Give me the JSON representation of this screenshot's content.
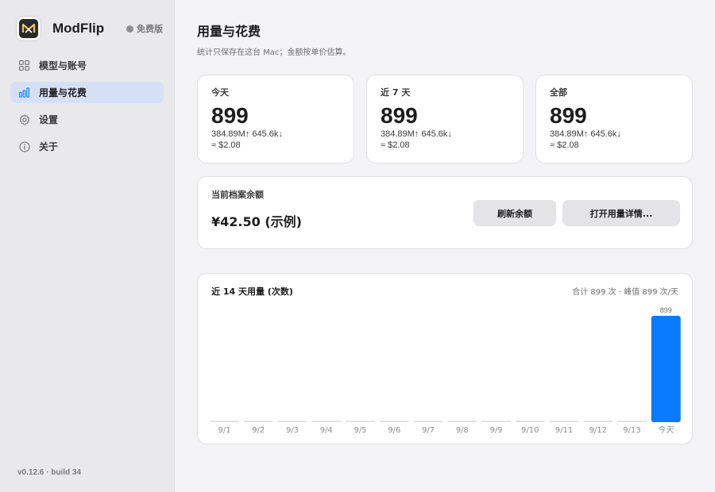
{
  "app": {
    "name": "ModFlip",
    "plan": "免费版",
    "version": "v0.12.6 · build 34"
  },
  "sidebar": {
    "items": [
      {
        "label": "模型与账号",
        "icon": "grid-icon",
        "active": false
      },
      {
        "label": "用量与花费",
        "icon": "bar-chart-icon",
        "active": true
      },
      {
        "label": "设置",
        "icon": "gear-icon",
        "active": false
      },
      {
        "label": "关于",
        "icon": "info-icon",
        "active": false
      }
    ]
  },
  "page": {
    "title": "用量与花费",
    "subtitle": "统计只保存在这台 Mac；金额按单价估算。"
  },
  "stats": [
    {
      "label": "今天",
      "value": "899",
      "tokens": "384.89M↑ 645.6k↓",
      "cost": "≈ $2.08"
    },
    {
      "label": "近 7 天",
      "value": "899",
      "tokens": "384.89M↑ 645.6k↓",
      "cost": "≈ $2.08"
    },
    {
      "label": "全部",
      "value": "899",
      "tokens": "384.89M↑ 645.6k↓",
      "cost": "≈ $2.08"
    }
  ],
  "balance": {
    "label": "当前档案余额",
    "value": "¥42.50 (示例)",
    "refresh_label": "刷新余额",
    "open_label": "打开用量详情..."
  },
  "chart": {
    "title": "近 14 天用量 (次数)",
    "summary": "合计 899 次 · 峰值 899 次/天"
  },
  "chart_data": {
    "type": "bar",
    "categories": [
      "9/1",
      "9/2",
      "9/3",
      "9/4",
      "9/5",
      "9/6",
      "9/7",
      "9/8",
      "9/9",
      "9/10",
      "9/11",
      "9/12",
      "9/13",
      "今天"
    ],
    "values": [
      0,
      0,
      0,
      0,
      0,
      0,
      0,
      0,
      0,
      0,
      0,
      0,
      0,
      899
    ],
    "data_labels": [
      "",
      "",
      "",
      "",
      "",
      "",
      "",
      "",
      "",
      "",
      "",
      "",
      "",
      "899"
    ],
    "ylim": [
      0,
      899
    ],
    "grid": false,
    "bar_color": "#0a7aff",
    "empty_color": "#e3e3e6"
  },
  "colors": {
    "accent": "#0a7aff",
    "active_nav": "#d6e0f5"
  }
}
